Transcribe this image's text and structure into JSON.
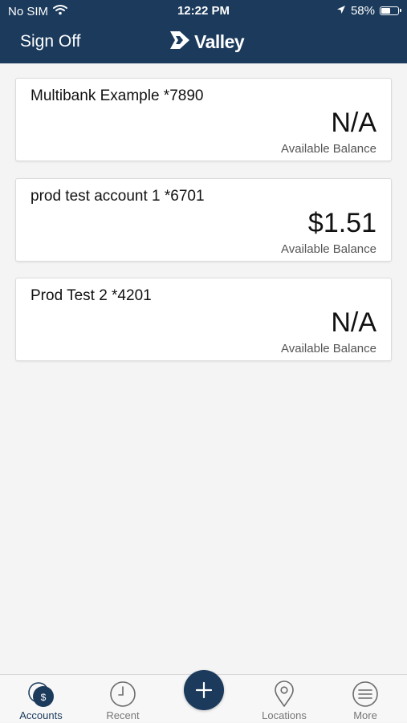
{
  "status_bar": {
    "carrier": "No SIM",
    "time": "12:22 PM",
    "battery": "58%",
    "battery_level": 0.58
  },
  "header": {
    "sign_off_label": "Sign Off",
    "logo_text": "Valley",
    "background_color": "#1b3a5c"
  },
  "accounts": [
    {
      "name": "Multibank Example *7890",
      "balance": "N/A",
      "balance_label": "Available Balance"
    },
    {
      "name": "prod test account 1 *6701",
      "balance": "$1.51",
      "balance_label": "Available Balance"
    },
    {
      "name": "Prod Test 2 *4201",
      "balance": "N/A",
      "balance_label": "Available Balance"
    }
  ],
  "tab_bar": {
    "active": "accounts",
    "accounts_label": "Accounts",
    "recent_label": "Recent",
    "locations_label": "Locations",
    "more_label": "More",
    "accounts_icon_glyph": "$",
    "add_icon": "plus-icon"
  }
}
